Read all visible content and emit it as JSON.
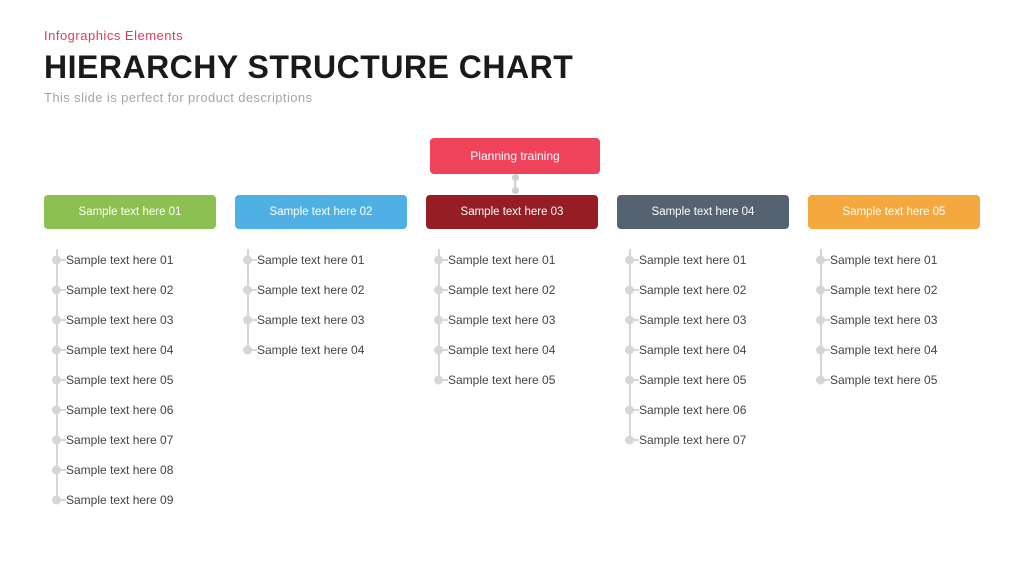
{
  "eyebrow": "Infographics Elements",
  "title": "HIERARCHY STRUCTURE CHART",
  "subtitle": "This slide is perfect for product descriptions",
  "top_box": "Planning training",
  "columns": [
    {
      "color": "#8cc152",
      "header": "Sample text here 01",
      "items": [
        "Sample text here 01",
        "Sample text here 02",
        "Sample text here 03",
        "Sample text here 04",
        "Sample text here 05",
        "Sample text here 06",
        "Sample text here 07",
        "Sample text here 08",
        "Sample text here 09"
      ]
    },
    {
      "color": "#4fb0e6",
      "header": "Sample text here 02",
      "items": [
        "Sample text here 01",
        "Sample text here 02",
        "Sample text here 03",
        "Sample text here 04"
      ]
    },
    {
      "color": "#961d23",
      "header": "Sample text here 03",
      "items": [
        "Sample text here 01",
        "Sample text here 02",
        "Sample text here 03",
        "Sample text here 04",
        "Sample text here 05"
      ]
    },
    {
      "color": "#556271",
      "header": "Sample text here 04",
      "items": [
        "Sample text here 01",
        "Sample text here 02",
        "Sample text here 03",
        "Sample text here 04",
        "Sample text here 05",
        "Sample text here 06",
        "Sample text here 07"
      ]
    },
    {
      "color": "#f4a83d",
      "header": "Sample text here 05",
      "items": [
        "Sample text here 01",
        "Sample text here 02",
        "Sample text here 03",
        "Sample text here 04",
        "Sample text here 05"
      ]
    }
  ]
}
